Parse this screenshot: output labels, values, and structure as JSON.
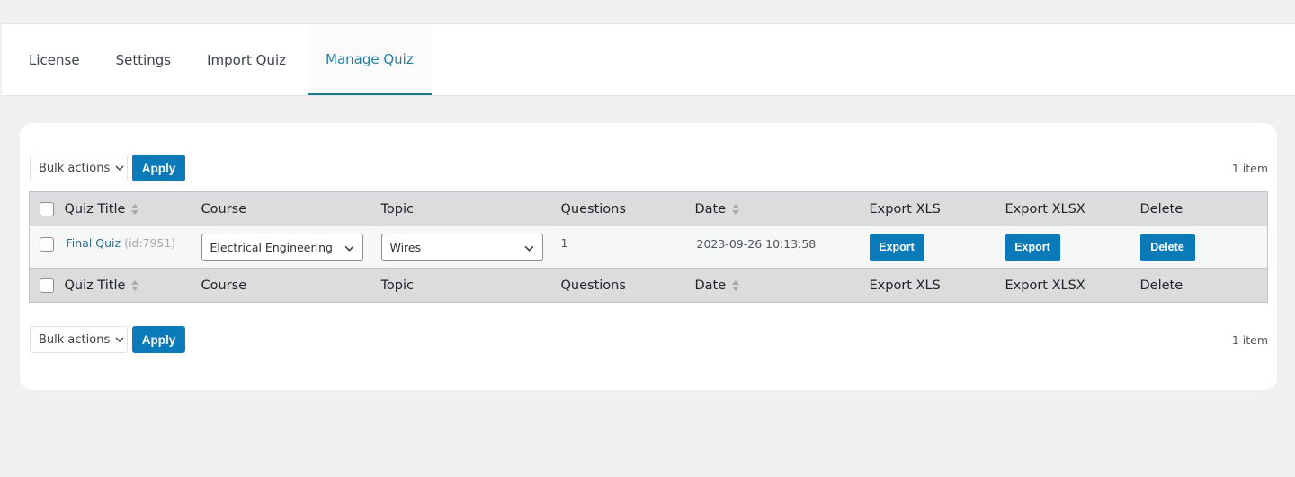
{
  "tabs": [
    {
      "label": "License",
      "active": false
    },
    {
      "label": "Settings",
      "active": false
    },
    {
      "label": "Import Quiz",
      "active": false
    },
    {
      "label": "Manage Quiz",
      "active": true
    }
  ],
  "toolbar": {
    "bulk_actions_label": "Bulk actions",
    "apply_label": "Apply",
    "item_count": "1 item"
  },
  "table": {
    "columns": {
      "quiz_title": "Quiz Title",
      "course": "Course",
      "topic": "Topic",
      "questions": "Questions",
      "date": "Date",
      "export_xls": "Export XLS",
      "export_xlsx": "Export XLSX",
      "delete": "Delete"
    },
    "rows": [
      {
        "title": "Final Quiz",
        "id_label": "(id:7951)",
        "course": "Electrical Engineering",
        "topic": "Wires",
        "questions": "1",
        "date": "2023-09-26 10:13:58",
        "export_xls_label": "Export",
        "export_xlsx_label": "Export",
        "delete_label": "Delete"
      }
    ]
  },
  "colors": {
    "accent": "#0a7ab8",
    "active_tab": "#2a7ea0",
    "header_bg": "#dcdcde"
  }
}
